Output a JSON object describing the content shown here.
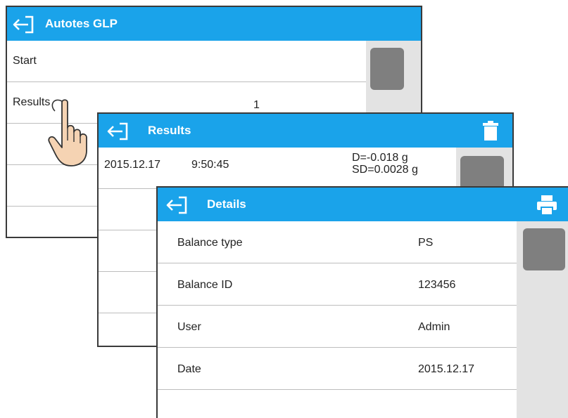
{
  "autotest_window": {
    "title": "Autotes GLP",
    "items": [
      {
        "label": "Start",
        "value": ""
      },
      {
        "label": "Results",
        "value": "1"
      },
      {
        "label": "",
        "value": ""
      },
      {
        "label": "",
        "value": ""
      },
      {
        "label": "",
        "value": ""
      }
    ]
  },
  "results_window": {
    "title": "Results",
    "entry": {
      "date": "2015.12.17",
      "time": "9:50:45",
      "d": "D=-0.018 g",
      "sd": "SD=0.0028 g"
    }
  },
  "details_window": {
    "title": "Details",
    "rows": [
      {
        "label": "Balance type",
        "value": "PS"
      },
      {
        "label": "Balance ID",
        "value": "123456"
      },
      {
        "label": "User",
        "value": "Admin"
      },
      {
        "label": "Date",
        "value": "2015.12.17"
      }
    ]
  },
  "icons": {
    "back": "back-arrow-icon",
    "delete": "trash-icon",
    "print": "printer-icon",
    "cursor": "pointing-hand-icon"
  },
  "colors": {
    "titlebar": "#1aa3ea",
    "scrollbar_track": "#e3e3e3",
    "scrollbar_thumb": "#7f7f7f",
    "border": "#3a3a3a",
    "row_divider": "#bdbdbd"
  }
}
